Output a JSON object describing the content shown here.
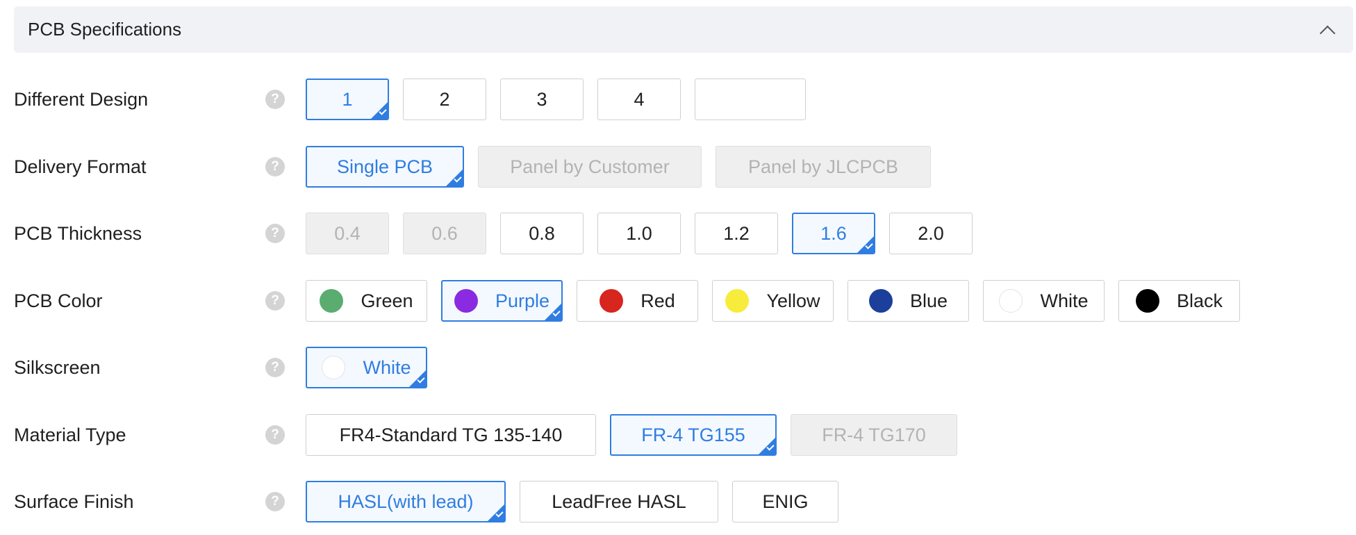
{
  "section": {
    "title": "PCB Specifications"
  },
  "colors": {
    "accent": "#2f7de1",
    "disabled_bg": "#efefef",
    "disabled_text": "#b3b3b3"
  },
  "rows": {
    "different_design": {
      "label": "Different Design",
      "options": [
        "1",
        "2",
        "3",
        "4",
        ""
      ],
      "selected": "1"
    },
    "delivery_format": {
      "label": "Delivery Format",
      "options": [
        "Single PCB",
        "Panel by Customer",
        "Panel by JLCPCB"
      ],
      "selected": "Single PCB",
      "disabled": [
        "Panel by Customer",
        "Panel by JLCPCB"
      ]
    },
    "pcb_thickness": {
      "label": "PCB Thickness",
      "options": [
        "0.4",
        "0.6",
        "0.8",
        "1.0",
        "1.2",
        "1.6",
        "2.0"
      ],
      "selected": "1.6",
      "disabled": [
        "0.4",
        "0.6"
      ]
    },
    "pcb_color": {
      "label": "PCB Color",
      "options": [
        {
          "name": "Green",
          "color": "#5aad6f"
        },
        {
          "name": "Purple",
          "color": "#8a2be2"
        },
        {
          "name": "Red",
          "color": "#d7261e"
        },
        {
          "name": "Yellow",
          "color": "#f7ec3b"
        },
        {
          "name": "Blue",
          "color": "#1c3f9b"
        },
        {
          "name": "White",
          "color": "#ffffff"
        },
        {
          "name": "Black",
          "color": "#000000"
        }
      ],
      "selected": "Purple"
    },
    "silkscreen": {
      "label": "Silkscreen",
      "options": [
        {
          "name": "White",
          "color": "#ffffff"
        }
      ],
      "selected": "White"
    },
    "material_type": {
      "label": "Material Type",
      "options": [
        "FR4-Standard TG 135-140",
        "FR-4 TG155",
        "FR-4 TG170"
      ],
      "selected": "FR-4 TG155",
      "disabled": [
        "FR-4 TG170"
      ]
    },
    "surface_finish": {
      "label": "Surface Finish",
      "options": [
        "HASL(with lead)",
        "LeadFree HASL",
        "ENIG"
      ],
      "selected": "HASL(with lead)"
    }
  },
  "help_glyph": "?"
}
